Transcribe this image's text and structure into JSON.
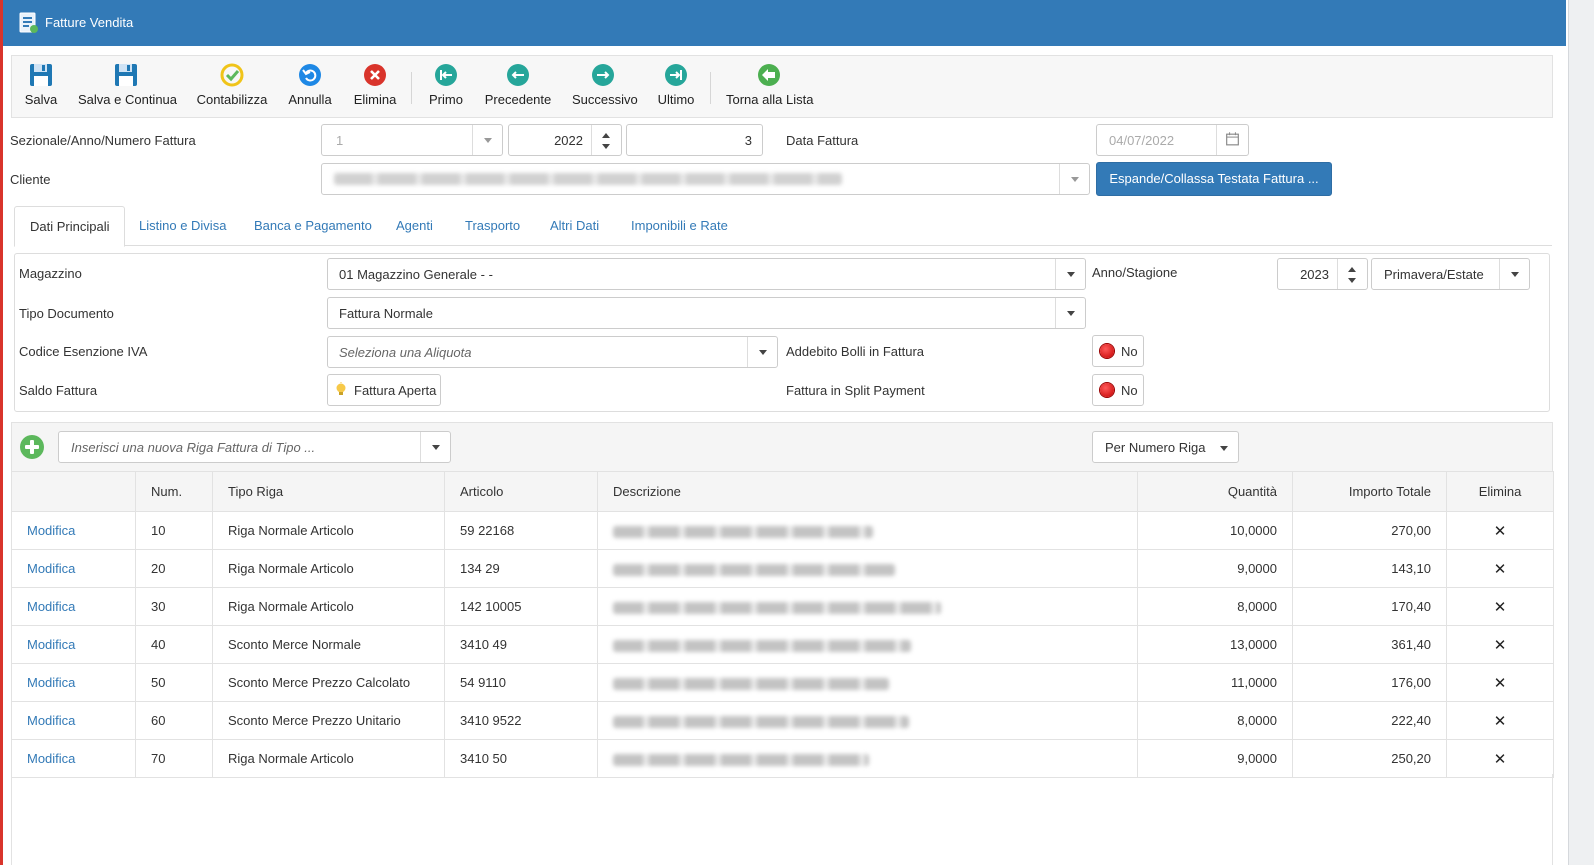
{
  "window": {
    "title": "Fatture Vendita"
  },
  "toolbar": {
    "save": "Salva",
    "save_continue": "Salva e Continua",
    "post": "Contabilizza",
    "undo": "Annulla",
    "delete": "Elimina",
    "first": "Primo",
    "previous": "Precedente",
    "next": "Successivo",
    "last": "Ultimo",
    "back_to_list": "Torna alla Lista"
  },
  "header": {
    "invoice_label": "Sezionale/Anno/Numero Fattura",
    "sezionale": "1",
    "anno": "2022",
    "numero": "3",
    "date_label": "Data Fattura",
    "date_value": "04/07/2022",
    "client_label": "Cliente",
    "expand_button": "Espande/Collassa Testata Fattura ..."
  },
  "tabs": [
    {
      "label": "Dati Principali",
      "active": true
    },
    {
      "label": "Listino e Divisa"
    },
    {
      "label": "Banca e Pagamento"
    },
    {
      "label": "Agenti"
    },
    {
      "label": "Trasporto"
    },
    {
      "label": "Altri Dati"
    },
    {
      "label": "Imponibili e Rate"
    }
  ],
  "main": {
    "warehouse_label": "Magazzino",
    "warehouse_value": "01 Magazzino Generale -  -",
    "season_label": "Anno/Stagione",
    "season_year": "2023",
    "season_value": "Primavera/Estate",
    "doc_type_label": "Tipo Documento",
    "doc_type_value": "Fattura Normale",
    "vat_label": "Codice Esenzione IVA",
    "vat_placeholder": "Seleziona una Aliquota",
    "stamp_label": "Addebito Bolli in Fattura",
    "stamp_value": "No",
    "balance_label": "Saldo Fattura",
    "balance_value": "Fattura Aperta",
    "split_label": "Fattura in Split Payment",
    "split_value": "No"
  },
  "rows_toolbar": {
    "new_row_placeholder": "Inserisci una nuova Riga Fattura di Tipo ...",
    "sort_value": "Per Numero Riga"
  },
  "grid": {
    "columns": [
      "",
      "Num.",
      "Tipo Riga",
      "Articolo",
      "Descrizione",
      "Quantità",
      "Importo Totale",
      "Elimina"
    ],
    "edit_label": "Modifica",
    "rows": [
      {
        "num": "10",
        "type": "Riga Normale Articolo",
        "article": "59 22168",
        "qty": "10,0000",
        "total": "270,00"
      },
      {
        "num": "20",
        "type": "Riga Normale Articolo",
        "article": "134 29",
        "qty": "9,0000",
        "total": "143,10"
      },
      {
        "num": "30",
        "type": "Riga Normale Articolo",
        "article": "142 10005",
        "qty": "8,0000",
        "total": "170,40"
      },
      {
        "num": "40",
        "type": "Sconto Merce Normale",
        "article": "3410 49",
        "qty": "13,0000",
        "total": "361,40"
      },
      {
        "num": "50",
        "type": "Sconto Merce Prezzo Calcolato",
        "article": "54 9110",
        "qty": "11,0000",
        "total": "176,00"
      },
      {
        "num": "60",
        "type": "Sconto Merce Prezzo Unitario",
        "article": "3410 9522",
        "qty": "8,0000",
        "total": "222,40"
      },
      {
        "num": "70",
        "type": "Riga Normale Articolo",
        "article": "3410 50",
        "qty": "9,0000",
        "total": "250,20"
      }
    ]
  },
  "colors": {
    "titlebar": "#337ab7",
    "link": "#337ab7",
    "add": "#5cb85c",
    "delete": "#d9342b"
  }
}
